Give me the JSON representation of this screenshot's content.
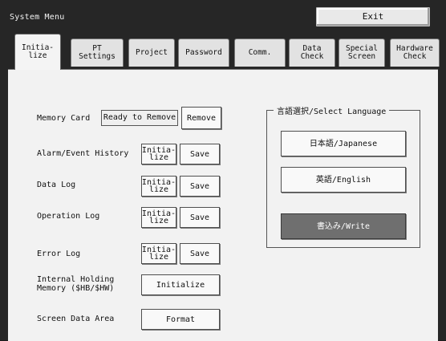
{
  "window": {
    "title": "System Menu",
    "exit_label": "Exit"
  },
  "tabs": [
    {
      "label": "Initia-\nlize",
      "active": true
    },
    {
      "label": "PT\nSettings",
      "active": false
    },
    {
      "label": "Project",
      "active": false
    },
    {
      "label": "Password",
      "active": false
    },
    {
      "label": "Comm.",
      "active": false
    },
    {
      "label": "Data\nCheck",
      "active": false
    },
    {
      "label": "Special\nScreen",
      "active": false
    },
    {
      "label": "Hardware\nCheck",
      "active": false
    }
  ],
  "memory_card": {
    "label": "Memory Card",
    "status": "Ready to Remove",
    "remove_label": "Remove"
  },
  "rows": [
    {
      "label": "Alarm/Event History",
      "init_label": "Initia-\nlize",
      "save_label": "Save"
    },
    {
      "label": "Data Log",
      "init_label": "Initia-\nlize",
      "save_label": "Save"
    },
    {
      "label": "Operation Log",
      "init_label": "Initia-\nlize",
      "save_label": "Save"
    },
    {
      "label": "Error Log",
      "init_label": "Initia-\nlize",
      "save_label": "Save"
    }
  ],
  "internal_memory": {
    "label": "Internal Holding\nMemory ($HB/$HW)",
    "button_label": "Initialize"
  },
  "screen_data": {
    "label": "Screen Data Area",
    "button_label": "Format"
  },
  "language": {
    "group_title": "言語選択/Select Language",
    "japanese_label": "日本語/Japanese",
    "english_label": "英語/English",
    "write_label": "書込み/Write"
  },
  "colors": {
    "background": "#262626",
    "panel": "#f2f2f2",
    "write_button": "#6f6f6f"
  }
}
